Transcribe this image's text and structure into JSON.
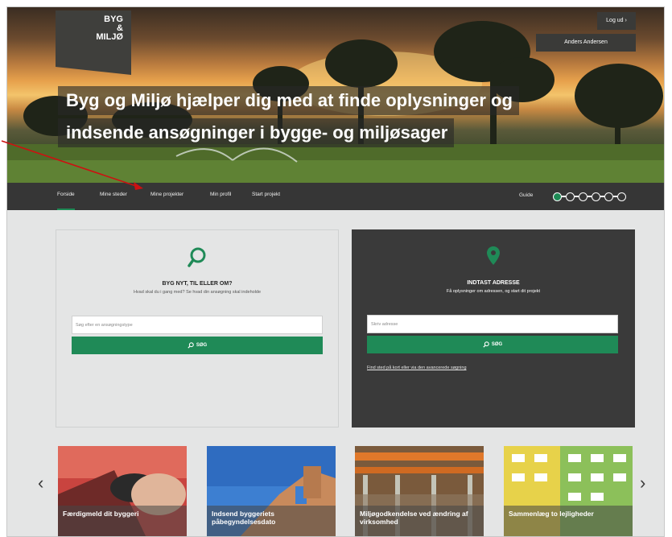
{
  "header": {
    "logo_lines": [
      "BYG",
      "&",
      "MILJØ"
    ],
    "logout_label": "Log ud ›",
    "user_name": "Anders Andersen",
    "headline_line1": "Byg og Miljø hjælper dig med at finde oplysninger og",
    "headline_line2": "indsende ansøgninger i bygge- og miljøsager"
  },
  "nav": {
    "items": [
      {
        "label": "Forside",
        "active": true
      },
      {
        "label": "Mine steder",
        "active": false
      },
      {
        "label": "Mine projekter",
        "active": false
      },
      {
        "label": "Min profil",
        "active": false
      },
      {
        "label": "Start projekt",
        "active": false
      }
    ],
    "guide_label": "Guide",
    "steps_total": 6,
    "steps_current": 1
  },
  "panel_left": {
    "icon": "search-icon",
    "title": "BYG NYT, TIL ELLER OM?",
    "subtitle": "Hvad skal du i gang med? Se hvad din ansøgning skal indeholde",
    "placeholder": "Søg efter en ansøgningstype",
    "button_label": "SØG"
  },
  "panel_right": {
    "icon": "map-pin-icon",
    "title": "INDTAST ADRESSE",
    "subtitle": "Få oplysninger om adressen, og start dit projekt",
    "placeholder": "Skriv adresse",
    "button_label": "SØG",
    "link_label": "Find sted på kort eller via den avancerede søgning"
  },
  "carousel": {
    "prev_label": "‹",
    "next_label": "›",
    "cards": [
      {
        "label": "Færdigmeld dit byggeri"
      },
      {
        "label": "Indsend byggeriets påbegyndelsesdato"
      },
      {
        "label": "Miljøgodkendelse ved ændring af virksomhed"
      },
      {
        "label": "Sammenlæg to lejligheder"
      }
    ]
  },
  "colors": {
    "accent_green": "#1f8a57",
    "nav_bg": "#363636",
    "dark_panel": "#3a3a3a",
    "annotation_arrow": "#cc1111"
  }
}
